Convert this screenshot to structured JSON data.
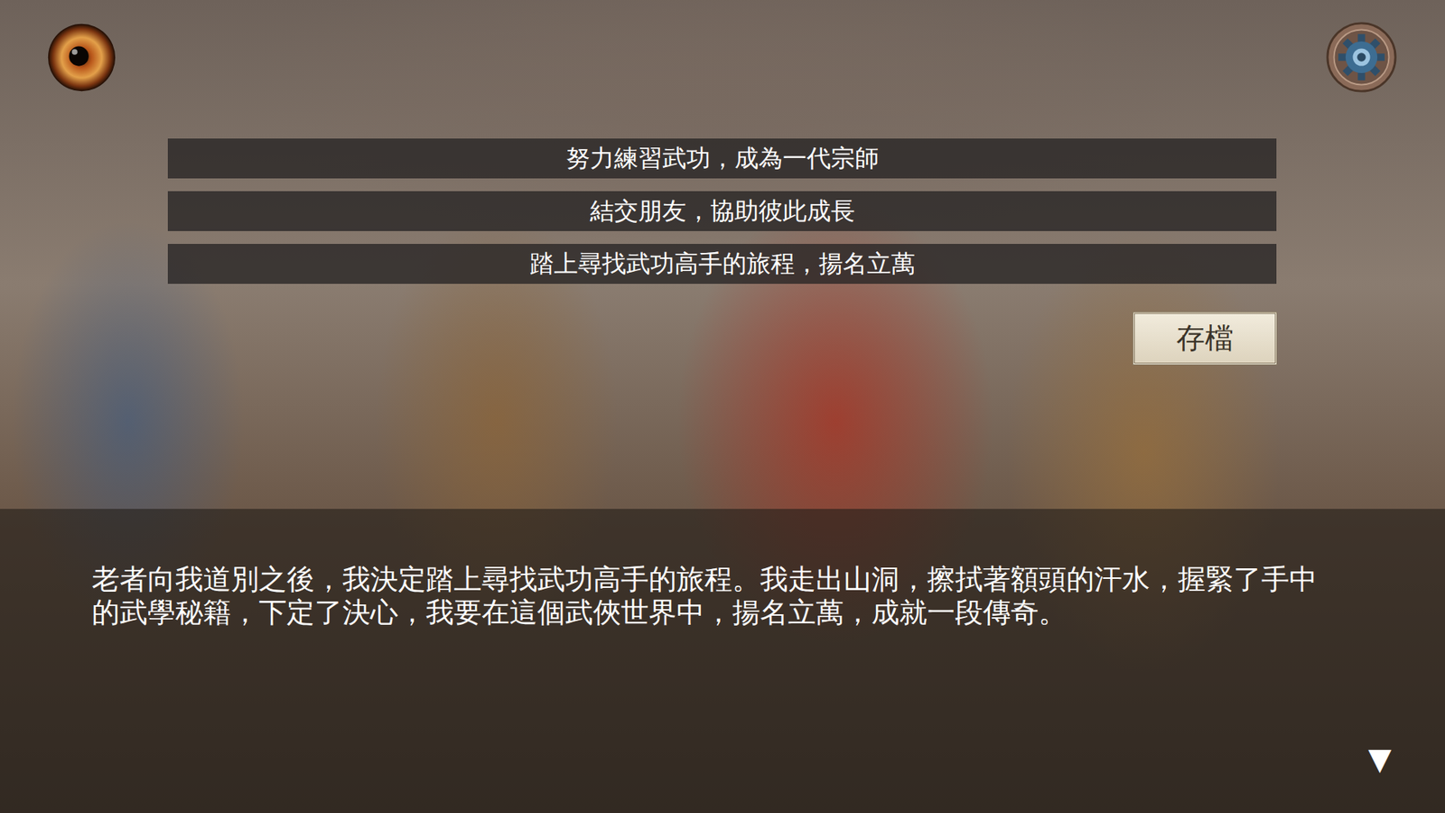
{
  "choices": [
    "努力練習武功，成為一代宗師",
    "結交朋友，協助彼此成長",
    "踏上尋找武功高手的旅程，揚名立萬"
  ],
  "save_button": "存檔",
  "dialogue": {
    "text": "老者向我道別之後，我決定踏上尋找武功高手的旅程。我走出山洞，擦拭著額頭的汗水，握緊了手中的武學秘籍，下定了決心，我要在這個武俠世界中，揚名立萬，成就一段傳奇。"
  },
  "advance_indicator": "▼"
}
